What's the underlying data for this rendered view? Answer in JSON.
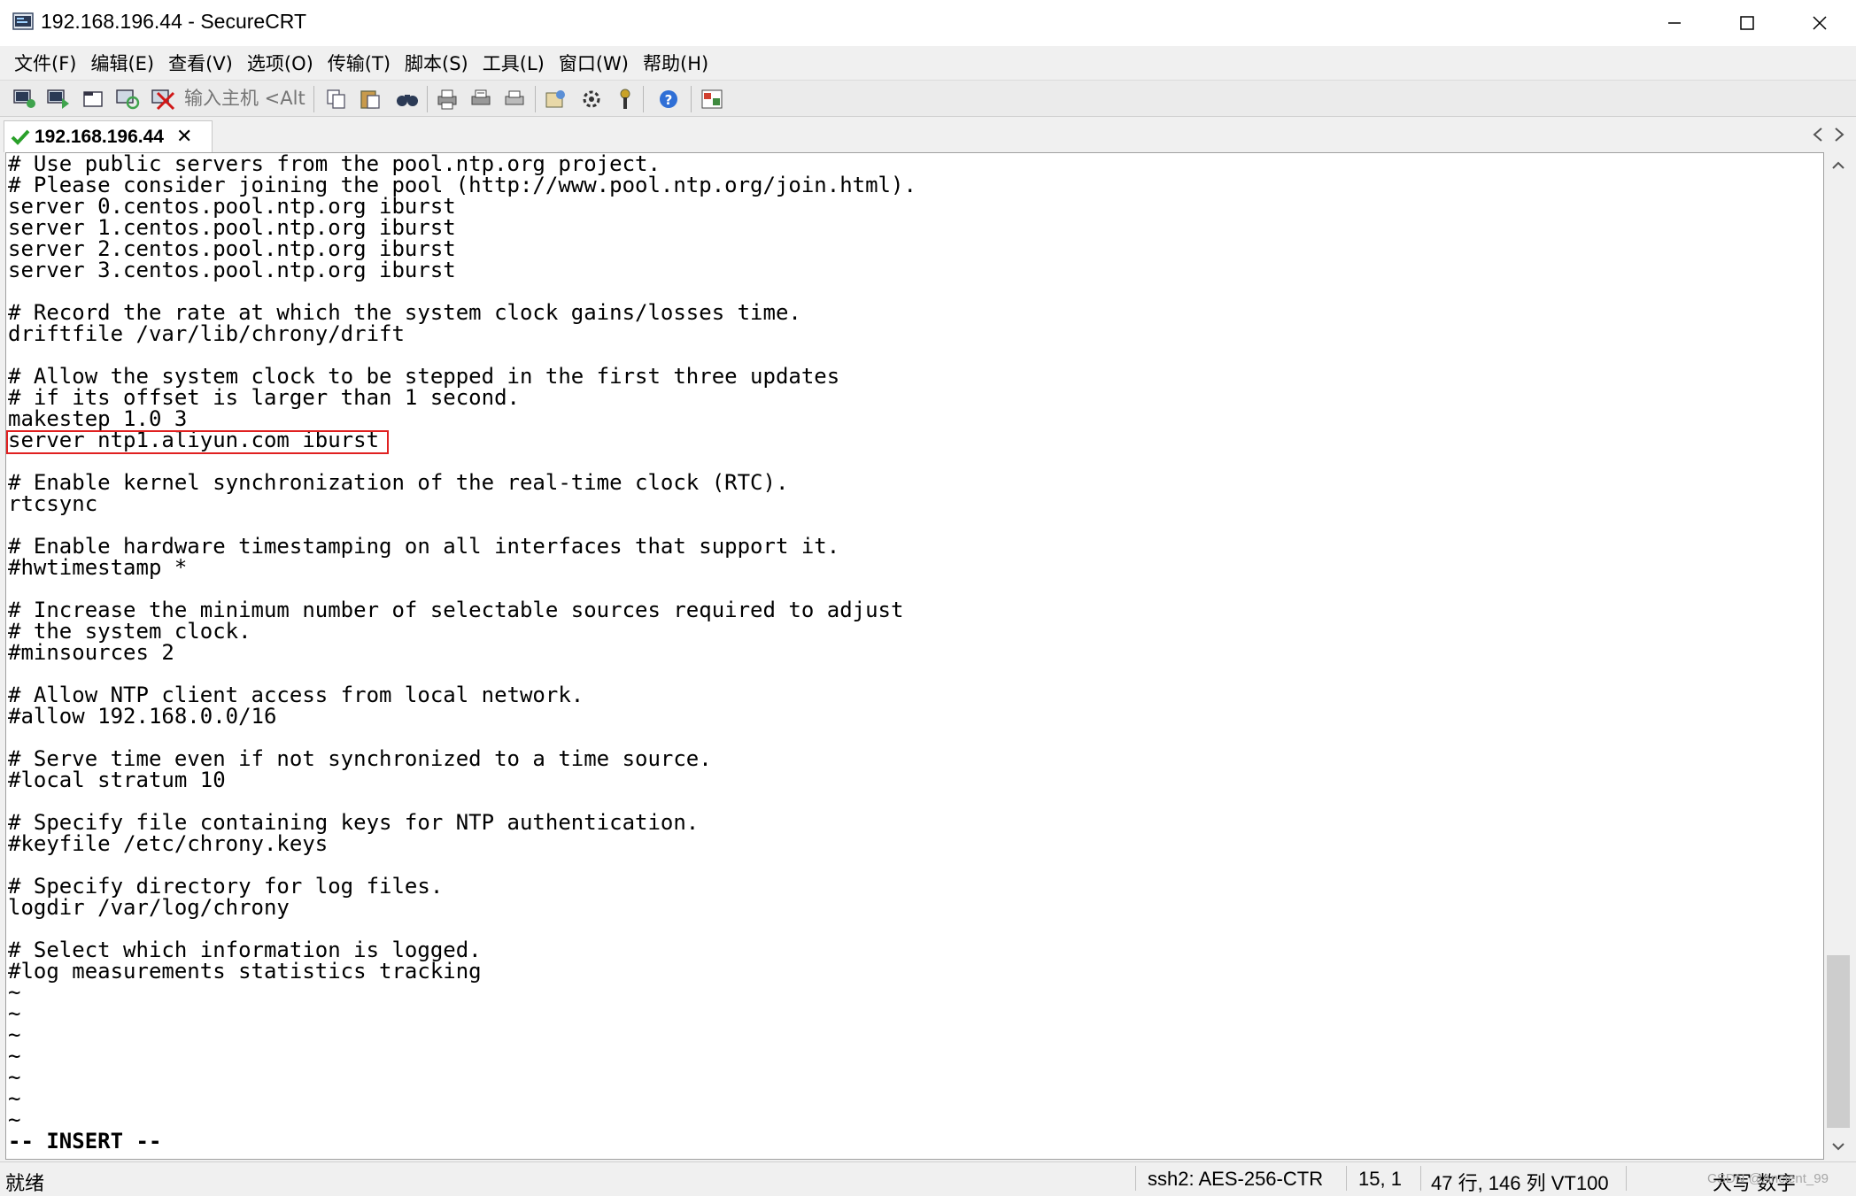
{
  "window": {
    "title": "192.168.196.44 - SecureCRT",
    "controls": [
      "minimize-icon",
      "maximize-icon",
      "close-icon"
    ]
  },
  "menu": {
    "items": [
      "文件(F)",
      "编辑(E)",
      "查看(V)",
      "选项(O)",
      "传输(T)",
      "脚本(S)",
      "工具(L)",
      "窗口(W)",
      "帮助(H)"
    ]
  },
  "toolbar": {
    "host_placeholder": "输入主机 <Alt+",
    "icons": [
      "connect-icon",
      "quick-connect-icon",
      "connect-in-tab-icon",
      "reconnect-icon",
      "disconnect-icon",
      "copy-icon",
      "paste-icon",
      "find-icon",
      "print-setup-icon",
      "print-selection-icon",
      "print-icon",
      "session-options-icon",
      "global-options-icon",
      "keymap-icon",
      "help-icon",
      "sftp-icon"
    ]
  },
  "tab": {
    "label": "192.168.196.44",
    "close": "✕"
  },
  "terminal": {
    "lines": [
      "# Use public servers from the pool.ntp.org project.",
      "# Please consider joining the pool (http://www.pool.ntp.org/join.html).",
      "server 0.centos.pool.ntp.org iburst",
      "server 1.centos.pool.ntp.org iburst",
      "server 2.centos.pool.ntp.org iburst",
      "server 3.centos.pool.ntp.org iburst",
      "",
      "# Record the rate at which the system clock gains/losses time.",
      "driftfile /var/lib/chrony/drift",
      "",
      "# Allow the system clock to be stepped in the first three updates",
      "# if its offset is larger than 1 second.",
      "makestep 1.0 3",
      "server ntp1.aliyun.com iburst",
      "",
      "# Enable kernel synchronization of the real-time clock (RTC).",
      "rtcsync",
      "",
      "# Enable hardware timestamping on all interfaces that support it.",
      "#hwtimestamp *",
      "",
      "# Increase the minimum number of selectable sources required to adjust",
      "# the system clock.",
      "#minsources 2",
      "",
      "# Allow NTP client access from local network.",
      "#allow 192.168.0.0/16",
      "",
      "# Serve time even if not synchronized to a time source.",
      "#local stratum 10",
      "",
      "# Specify file containing keys for NTP authentication.",
      "#keyfile /etc/chrony.keys",
      "",
      "# Specify directory for log files.",
      "logdir /var/log/chrony",
      "",
      "# Select which information is logged.",
      "#log measurements statistics tracking",
      "~",
      "~",
      "~",
      "~",
      "~",
      "~",
      "~",
      "-- INSERT --"
    ],
    "highlighted_line": "server ntp1.aliyun.com iburst"
  },
  "status": {
    "ready": "就绪",
    "encryption": "ssh2: AES-256-CTR",
    "cursor": "15,   1",
    "size": "47 行, 146 列 VT100",
    "ime": "大写 数字",
    "watermark": "CSDN @Ancient_99"
  },
  "colors": {
    "highlight_box": "#e02020",
    "terminal_bg": "#ffffff"
  }
}
